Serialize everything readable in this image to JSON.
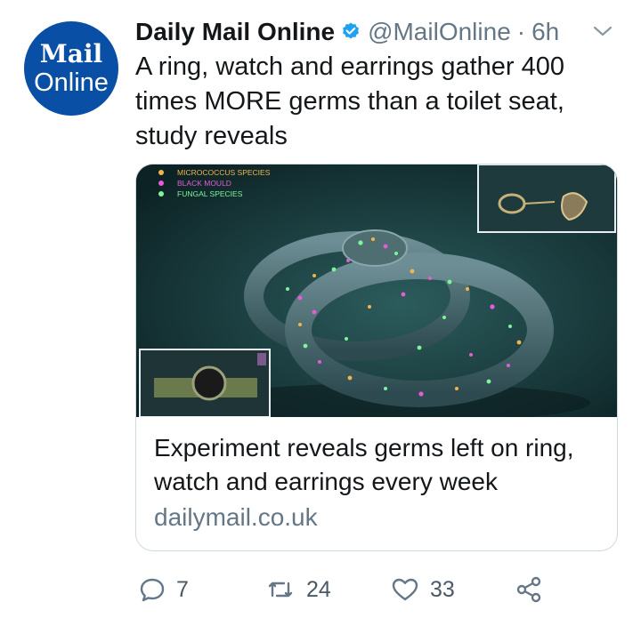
{
  "avatar": {
    "line1": "Mail",
    "line2": "Online"
  },
  "tweet": {
    "display_name": "Daily Mail Online",
    "handle": "@MailOnline",
    "separator": "·",
    "time": "6h",
    "text": "A ring, watch and earrings gather 400 times MORE germs than a toilet seat, study reveals"
  },
  "card": {
    "image_legend": [
      "MICROCOCCUS SPECIES",
      "BLACK MOULD",
      "FUNGAL SPECIES"
    ],
    "title": "Experiment reveals germs left on ring, watch and earrings every week",
    "domain": "dailymail.co.uk"
  },
  "actions": {
    "replies": "7",
    "retweets": "24",
    "likes": "33"
  },
  "colors": {
    "brand": "#0a4fa6",
    "verified": "#1da1f2",
    "muted": "#657786"
  },
  "icons": [
    "verified-badge-icon",
    "chevron-down-icon",
    "reply-icon",
    "retweet-icon",
    "like-icon",
    "share-icon"
  ]
}
